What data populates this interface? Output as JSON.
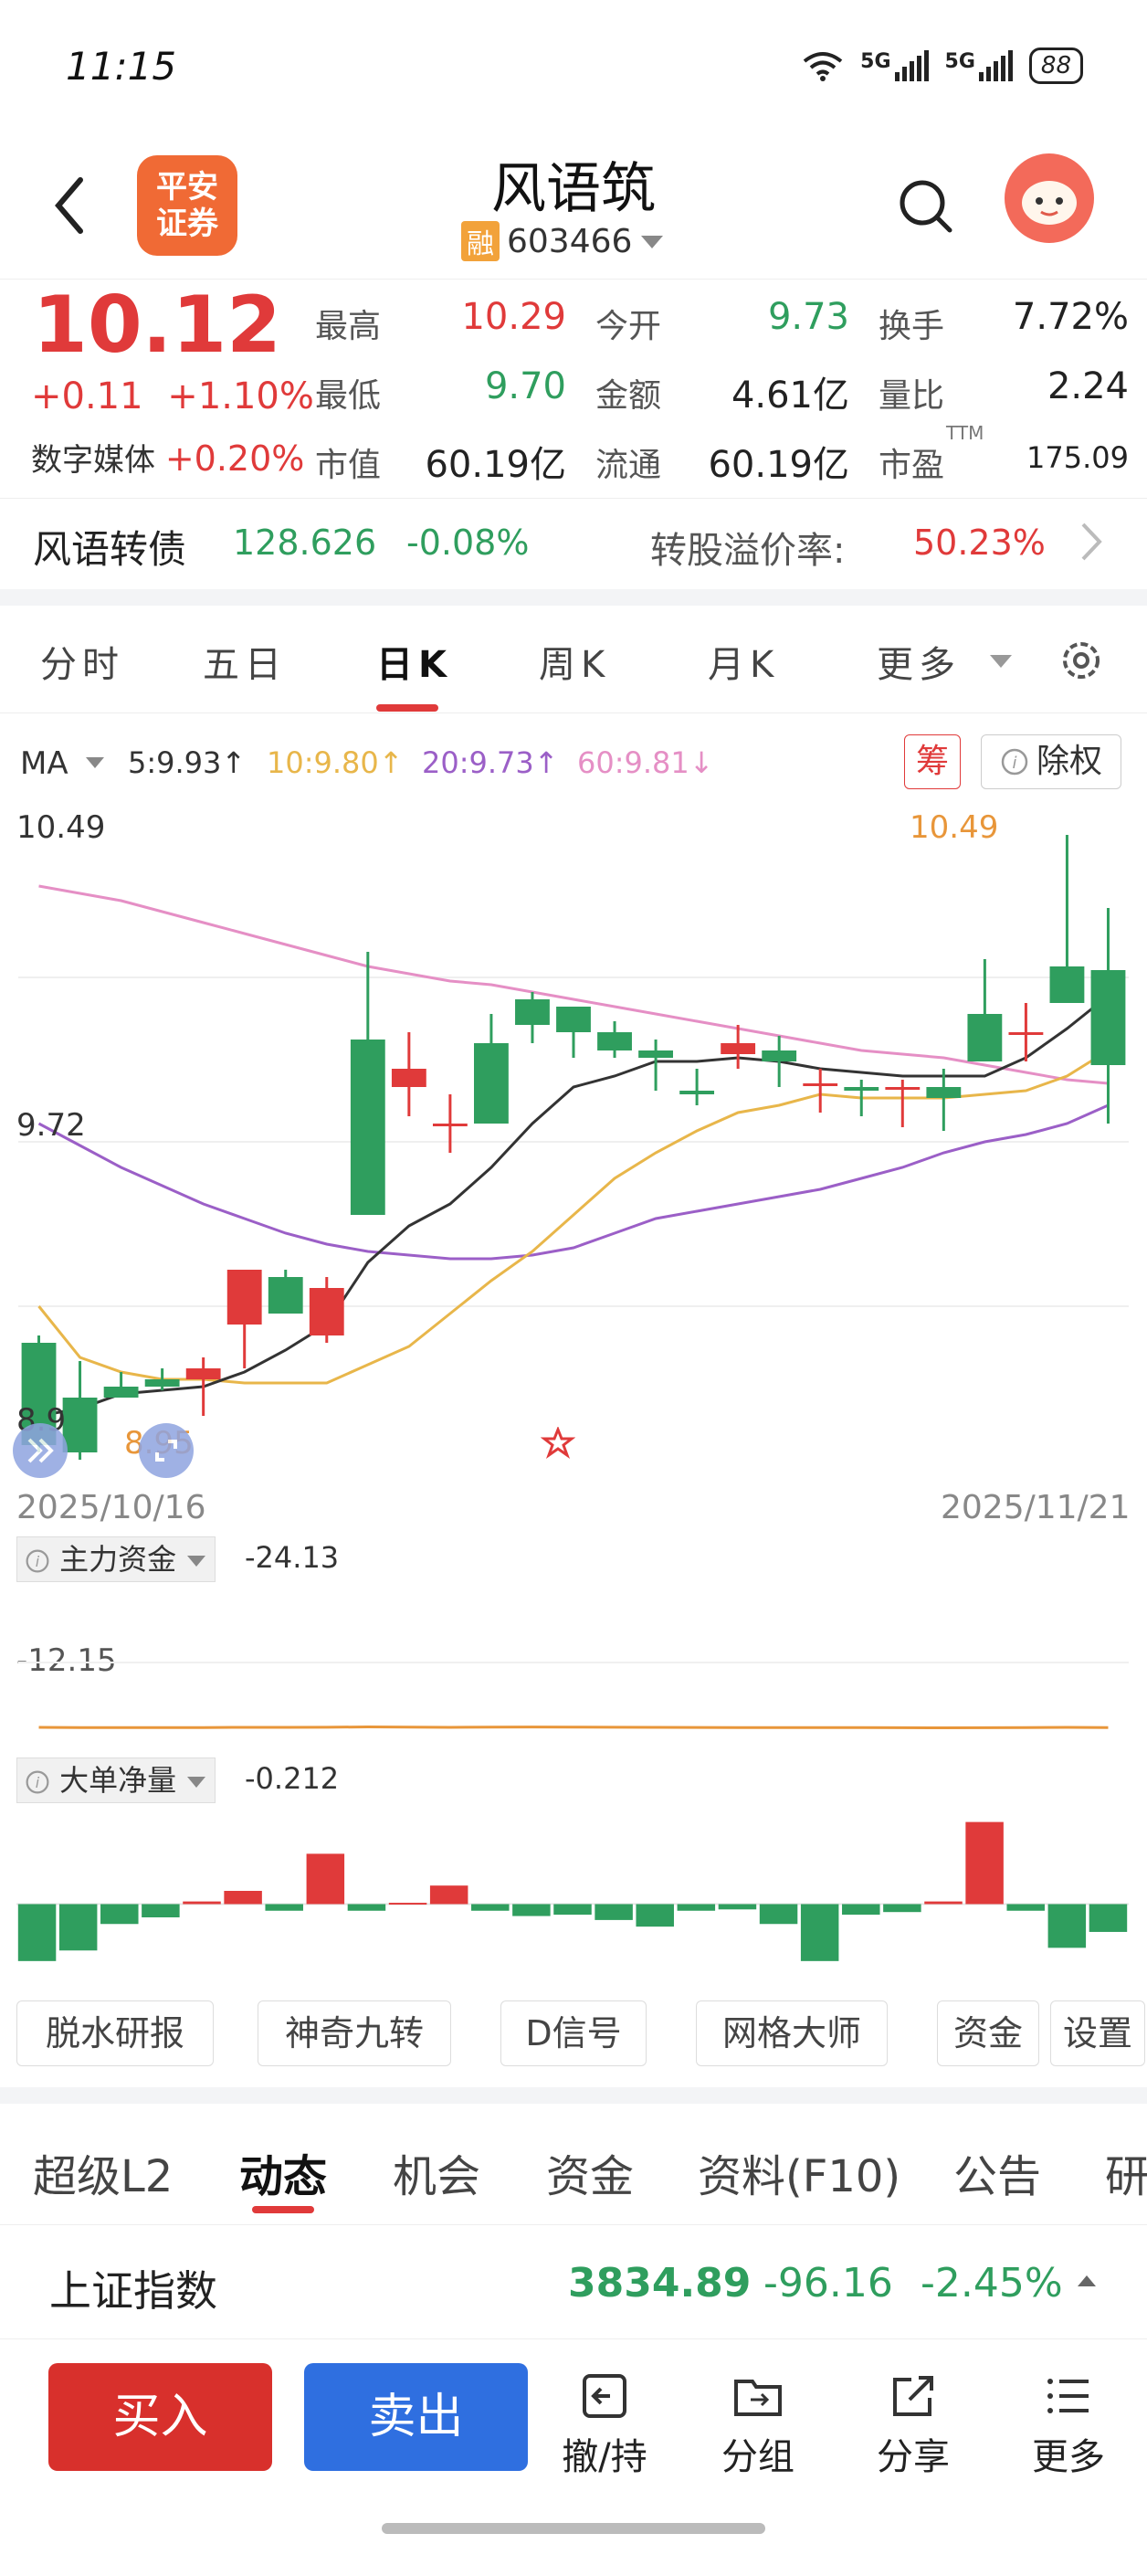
{
  "status": {
    "time": "11:15",
    "net1": "5G",
    "net2": "5G",
    "battery": "88"
  },
  "header": {
    "broker_logo": "平安\n证券",
    "stock_name": "风语筑",
    "margin_tag": "融",
    "stock_code": "603466",
    "icons": [
      "back-icon",
      "search-icon",
      "avatar-icon",
      "dropdown-icon"
    ]
  },
  "quote": {
    "price": "10.12",
    "change": "+0.11",
    "change_pct": "+1.10%",
    "sector_label": "数字媒体",
    "sector_pct": "+0.20%",
    "fields": {
      "high_label": "最高",
      "high": "10.29",
      "low_label": "最低",
      "low": "9.70",
      "mktcap_label": "市值",
      "mktcap": "60.19亿",
      "open_label": "今开",
      "open": "9.73",
      "amount_label": "金额",
      "amount": "4.61亿",
      "float_label": "流通",
      "float": "60.19亿",
      "turnover_label": "换手",
      "turnover": "7.72%",
      "volratio_label": "量比",
      "volratio": "2.24",
      "pe_label": "市盈",
      "pe_sup": "TTM",
      "pe": "175.09"
    }
  },
  "bond": {
    "name": "风语转债",
    "price": "128.626",
    "pct": "-0.08%",
    "premium_label": "转股溢价率:",
    "premium": "50.23%"
  },
  "chart_tabs": [
    "分时",
    "五日",
    "日K",
    "周K",
    "月K",
    "更多"
  ],
  "ma": {
    "label": "MA",
    "ma5": "5:9.93↑",
    "ma10": "10:9.80↑",
    "ma20": "20:9.73↑",
    "ma60": "60:9.81↓",
    "chip_btn": "筹",
    "adjust_btn": "除权",
    "colors": {
      "ma5": "#333333",
      "ma10": "#e8b64a",
      "ma20": "#9b5fc7",
      "ma60": "#e58fc5",
      "up": "#e03a3a",
      "down": "#2f9e5e"
    }
  },
  "price_axis": {
    "high_label": "10.49",
    "mid_label": "9.72",
    "low_label": "8.9",
    "max_marker": "10.49",
    "min_marker": "8.95"
  },
  "date_axis": {
    "start": "2025/10/16",
    "end": "2025/11/21"
  },
  "chart_data": [
    {
      "type": "candlestick",
      "title": "",
      "x": [
        "2025/10/16",
        "",
        "",
        "",
        "",
        "",
        "",
        "",
        "",
        "",
        "",
        "",
        "",
        "",
        "",
        "",
        "",
        "",
        "",
        "",
        "",
        "",
        "",
        "",
        "",
        "",
        "2025/11/21"
      ],
      "ohlc": [
        [
          9.1,
          9.12,
          8.8,
          8.82
        ],
        [
          8.95,
          9.05,
          8.78,
          8.8
        ],
        [
          8.98,
          9.02,
          8.95,
          8.95
        ],
        [
          9.0,
          9.03,
          8.97,
          8.98
        ],
        [
          9.0,
          9.06,
          8.9,
          9.03
        ],
        [
          9.15,
          9.22,
          9.03,
          9.3
        ],
        [
          9.28,
          9.3,
          9.2,
          9.18
        ],
        [
          9.12,
          9.28,
          9.1,
          9.25
        ],
        [
          9.93,
          10.17,
          9.6,
          9.45
        ],
        [
          9.8,
          9.95,
          9.72,
          9.85
        ],
        [
          9.7,
          9.78,
          9.62,
          9.7
        ],
        [
          9.92,
          10.0,
          9.82,
          9.7
        ],
        [
          10.04,
          10.06,
          9.92,
          9.97
        ],
        [
          10.02,
          10.02,
          9.88,
          9.95
        ],
        [
          9.95,
          9.98,
          9.88,
          9.9
        ],
        [
          9.9,
          9.93,
          9.79,
          9.88
        ],
        [
          9.79,
          9.85,
          9.75,
          9.78
        ],
        [
          9.89,
          9.97,
          9.85,
          9.92
        ],
        [
          9.9,
          9.94,
          9.8,
          9.87
        ],
        [
          9.81,
          9.85,
          9.73,
          9.81
        ],
        [
          9.8,
          9.82,
          9.72,
          9.79
        ],
        [
          9.8,
          9.82,
          9.69,
          9.8
        ],
        [
          9.8,
          9.85,
          9.68,
          9.77
        ],
        [
          10.0,
          10.15,
          9.87,
          9.87
        ],
        [
          9.95,
          10.03,
          9.87,
          9.95
        ],
        [
          10.13,
          10.49,
          10.04,
          10.03
        ],
        [
          10.12,
          10.29,
          9.7,
          9.86
        ]
      ],
      "ma5": [
        8.9,
        8.92,
        8.96,
        8.97,
        8.98,
        9.02,
        9.08,
        9.15,
        9.32,
        9.42,
        9.48,
        9.58,
        9.7,
        9.8,
        9.83,
        9.87,
        9.87,
        9.88,
        9.87,
        9.85,
        9.84,
        9.83,
        9.83,
        9.83,
        9.88,
        9.96,
        10.05
      ],
      "ma10": [
        9.2,
        9.06,
        9.02,
        9.0,
        9.0,
        8.99,
        8.99,
        8.99,
        9.04,
        9.09,
        9.18,
        9.27,
        9.35,
        9.45,
        9.55,
        9.62,
        9.68,
        9.73,
        9.75,
        9.78,
        9.77,
        9.77,
        9.77,
        9.78,
        9.79,
        9.83,
        9.9
      ],
      "ma20": [
        9.7,
        9.64,
        9.58,
        9.53,
        9.48,
        9.44,
        9.4,
        9.37,
        9.35,
        9.34,
        9.33,
        9.33,
        9.34,
        9.36,
        9.4,
        9.44,
        9.46,
        9.48,
        9.5,
        9.52,
        9.55,
        9.58,
        9.62,
        9.65,
        9.67,
        9.7,
        9.75
      ],
      "ma60": [
        10.35,
        10.33,
        10.31,
        10.28,
        10.25,
        10.22,
        10.19,
        10.16,
        10.13,
        10.11,
        10.09,
        10.08,
        10.06,
        10.04,
        10.02,
        10.0,
        9.98,
        9.96,
        9.94,
        9.92,
        9.9,
        9.89,
        9.88,
        9.86,
        9.84,
        9.82,
        9.81
      ],
      "ylim": [
        8.75,
        10.55
      ]
    },
    {
      "type": "line",
      "name": "主力资金",
      "value_label": "-24.13",
      "axis_label": "-12.15",
      "values": [
        -24.1,
        -24.12,
        -24.13,
        -24.13,
        -24.12,
        -24.1,
        -24.1,
        -24.09,
        -24.05,
        -24.08,
        -24.1,
        -24.08,
        -24.06,
        -24.07,
        -24.09,
        -24.1,
        -24.11,
        -24.12,
        -24.12,
        -24.13,
        -24.13,
        -24.14,
        -24.15,
        -24.14,
        -24.12,
        -24.1,
        -24.13
      ],
      "ylim": [
        -26,
        -10
      ]
    },
    {
      "type": "bar",
      "name": "大单净量",
      "value_label": "-0.212",
      "values": [
        -0.43,
        -0.35,
        -0.15,
        -0.1,
        0.02,
        0.1,
        -0.05,
        0.38,
        -0.05,
        0.01,
        0.14,
        -0.05,
        -0.09,
        -0.08,
        -0.12,
        -0.17,
        -0.05,
        -0.04,
        -0.15,
        -0.43,
        -0.08,
        -0.06,
        0.02,
        0.62,
        -0.05,
        -0.33,
        -0.21
      ],
      "ylim": [
        -0.5,
        0.7
      ]
    }
  ],
  "tools": [
    "脱水研报",
    "神奇九转",
    "D信号",
    "网格大师",
    "资金",
    "设置"
  ],
  "info_tabs": [
    "超级L2",
    "动态",
    "机会",
    "资金",
    "资料(F10)",
    "公告",
    "研"
  ],
  "index": {
    "name": "上证指数",
    "value": "3834.89",
    "change": "-96.16",
    "pct": "-2.45%"
  },
  "bottom": {
    "buy": "买入",
    "sell": "卖出",
    "revoke": "撤/持",
    "group": "分组",
    "share": "分享",
    "more": "更多"
  }
}
